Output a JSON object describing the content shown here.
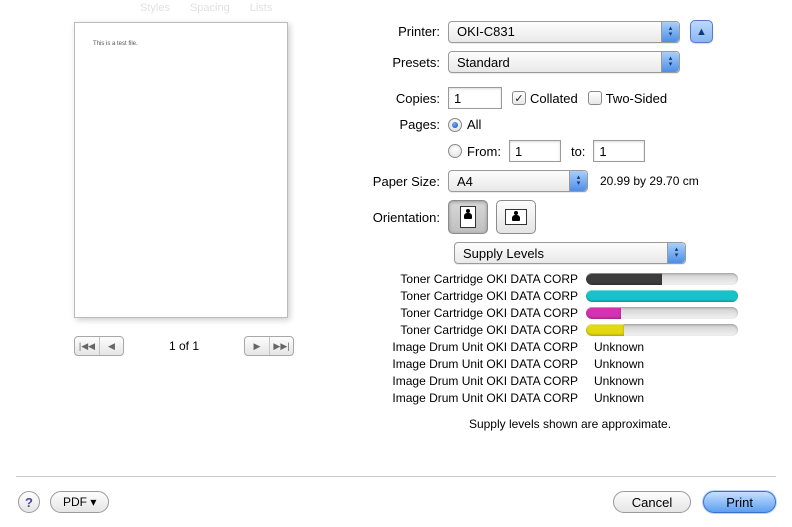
{
  "toolbar_ghost": [
    "Styles",
    "Spacing",
    "Lists"
  ],
  "preview": {
    "text": "This is a test file.",
    "page_counter": "1 of 1"
  },
  "printer": {
    "label": "Printer:",
    "value": "OKI-C831"
  },
  "presets": {
    "label": "Presets:",
    "value": "Standard"
  },
  "copies": {
    "label": "Copies:",
    "value": "1",
    "collated_label": "Collated",
    "collated": true,
    "twosided_label": "Two-Sided",
    "twosided": false
  },
  "pages": {
    "label": "Pages:",
    "all_label": "All",
    "from_label": "From:",
    "to_label": "to:",
    "from_value": "1",
    "to_value": "1",
    "selected": "all"
  },
  "paper": {
    "label": "Paper Size:",
    "value": "A4",
    "dims": "20.99 by 29.70 cm"
  },
  "orientation": {
    "label": "Orientation:"
  },
  "section_select": {
    "value": "Supply Levels"
  },
  "supplies": [
    {
      "label": "Toner Cartridge OKI DATA CORP",
      "percent": 50,
      "color": "#3d3d3d"
    },
    {
      "label": "Toner Cartridge OKI DATA CORP",
      "percent": 100,
      "color": "#17c3c9"
    },
    {
      "label": "Toner Cartridge OKI DATA CORP",
      "percent": 23,
      "color": "#d531b3"
    },
    {
      "label": "Toner Cartridge OKI DATA CORP",
      "percent": 25,
      "color": "#e2d912"
    },
    {
      "label": "Image Drum Unit OKI DATA CORP",
      "value": "Unknown"
    },
    {
      "label": "Image Drum Unit OKI DATA CORP",
      "value": "Unknown"
    },
    {
      "label": "Image Drum Unit OKI DATA CORP",
      "value": "Unknown"
    },
    {
      "label": "Image Drum Unit OKI DATA CORP",
      "value": "Unknown"
    }
  ],
  "approx": "Supply levels shown are approximate.",
  "footer": {
    "pdf": "PDF ▾",
    "cancel": "Cancel",
    "print": "Print",
    "help": "?"
  }
}
